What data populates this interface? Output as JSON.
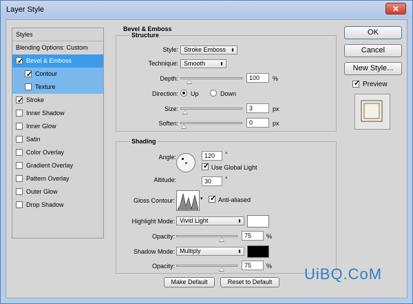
{
  "window": {
    "title": "Layer Style",
    "close_glyph": "✕"
  },
  "left_panel": {
    "header": "Styles",
    "items": [
      {
        "label": "Blending Options: Custom",
        "checkbox": false,
        "checked": false,
        "state": "normal"
      },
      {
        "label": "Bevel & Emboss",
        "checkbox": true,
        "checked": true,
        "state": "selected"
      },
      {
        "label": "Contour",
        "checkbox": true,
        "checked": true,
        "state": "subselected"
      },
      {
        "label": "Texture",
        "checkbox": true,
        "checked": false,
        "state": "subselected"
      },
      {
        "label": "Stroke",
        "checkbox": true,
        "checked": true,
        "state": "normal"
      },
      {
        "label": "Inner Shadow",
        "checkbox": true,
        "checked": false,
        "state": "normal"
      },
      {
        "label": "Inner Glow",
        "checkbox": true,
        "checked": false,
        "state": "normal"
      },
      {
        "label": "Satin",
        "checkbox": true,
        "checked": false,
        "state": "normal"
      },
      {
        "label": "Color Overlay",
        "checkbox": true,
        "checked": false,
        "state": "normal"
      },
      {
        "label": "Gradient Overlay",
        "checkbox": true,
        "checked": false,
        "state": "normal"
      },
      {
        "label": "Pattern Overlay",
        "checkbox": true,
        "checked": false,
        "state": "normal"
      },
      {
        "label": "Outer Glow",
        "checkbox": true,
        "checked": false,
        "state": "normal"
      },
      {
        "label": "Drop Shadow",
        "checkbox": true,
        "checked": false,
        "state": "normal"
      }
    ]
  },
  "bevel": {
    "group_title": "Bevel & Emboss",
    "structure": {
      "title": "Structure",
      "style_label": "Style:",
      "style_value": "Stroke Emboss",
      "technique_label": "Technique:",
      "technique_value": "Smooth",
      "depth_label": "Depth:",
      "depth_value": "100",
      "depth_unit": "%",
      "depth_slider": 0.1,
      "direction_label": "Direction:",
      "dir_up": "Up",
      "dir_down": "Down",
      "direction_selected": "Up",
      "size_label": "Size:",
      "size_value": "3",
      "size_unit": "px",
      "size_slider": 0.02,
      "soften_label": "Soften:",
      "soften_value": "0",
      "soften_unit": "px",
      "soften_slider": 0.0
    },
    "shading": {
      "title": "Shading",
      "angle_label": "Angle:",
      "angle_value": "120",
      "angle_unit": "°",
      "use_global_light_label": "Use Global Light",
      "use_global_light": true,
      "altitude_label": "Altitude:",
      "altitude_value": "30",
      "altitude_unit": "°",
      "gloss_contour_label": "Gloss Contour:",
      "anti_aliased_label": "Anti-aliased",
      "anti_aliased": true,
      "highlight_mode_label": "Highlight Mode:",
      "highlight_mode_value": "Vivid Light",
      "highlight_color": "#ffffff",
      "highlight_opacity_label": "Opacity:",
      "highlight_opacity_value": "75",
      "highlight_opacity_unit": "%",
      "highlight_opacity_slider": 0.75,
      "shadow_mode_label": "Shadow Mode:",
      "shadow_mode_value": "Multiply",
      "shadow_color": "#000000",
      "shadow_opacity_label": "Opacity:",
      "shadow_opacity_value": "75",
      "shadow_opacity_unit": "%",
      "shadow_opacity_slider": 0.75
    },
    "make_default_label": "Make Default",
    "reset_default_label": "Reset to Default"
  },
  "right": {
    "ok_label": "OK",
    "cancel_label": "Cancel",
    "new_style_label": "New Style...",
    "preview_label": "Preview",
    "preview_checked": true
  },
  "watermark": "UiBQ.CoM"
}
